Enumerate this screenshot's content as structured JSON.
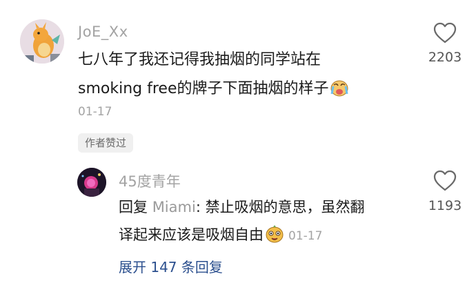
{
  "comment": {
    "username": "JoE_Xx",
    "text_line1": "七八年了我还记得我抽烟的同学站在",
    "text_line2": "smoking free的牌子下面抽烟的样子",
    "emoji_icon": "crying-face-icon",
    "date": "01-17",
    "badge": "作者赞过",
    "like_count": "2203"
  },
  "reply": {
    "username": "45度青年",
    "prefix": "回复",
    "mention": "Miami",
    "text_line1_after_mention": ": 禁止吸烟的意思，虽然翻",
    "text_line2": "译起来应该是吸烟自由",
    "emoji_icon": "smiling-face-icon",
    "date": "01-17",
    "like_count": "1193"
  },
  "expand_label": "展开 147 条回复",
  "colors": {
    "link": "#2b4f8e",
    "muted": "#a3a3a3"
  }
}
